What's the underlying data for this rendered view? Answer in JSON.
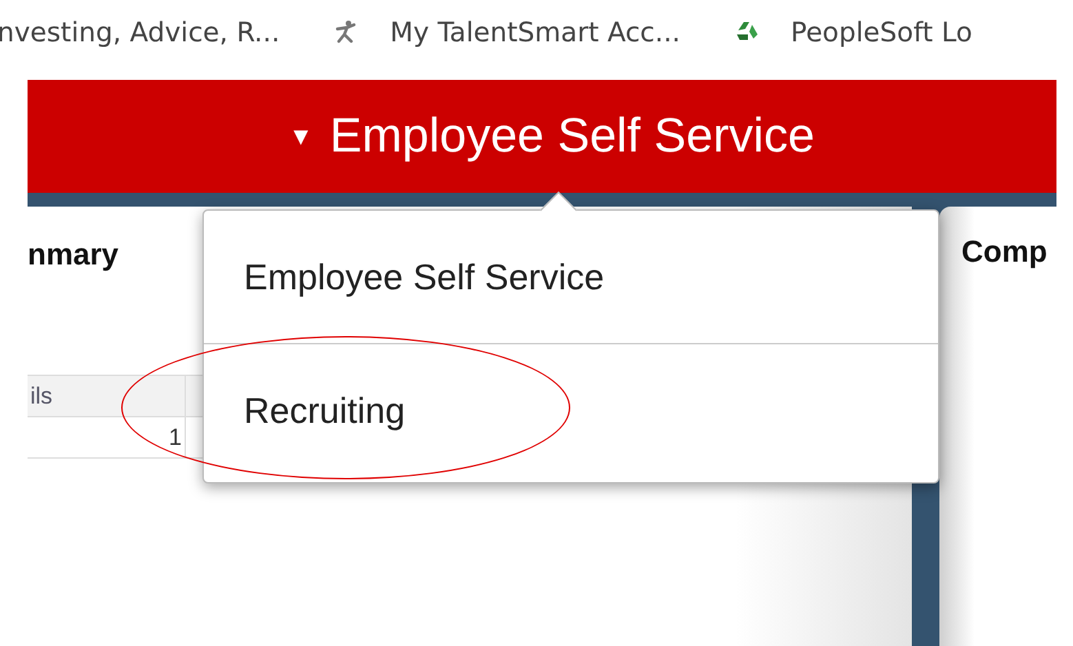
{
  "bookmarks": [
    {
      "label": "nvesting, Advice, R..."
    },
    {
      "label": "My TalentSmart Acc..."
    },
    {
      "label": "PeopleSoft Lo"
    }
  ],
  "header": {
    "caret": "▼",
    "title": "Employee Self Service"
  },
  "left_tile": {
    "title": "nmary",
    "columns": [
      "ils"
    ],
    "rows": [
      [
        "1",
        ""
      ]
    ]
  },
  "right_tile": {
    "title": "Comp"
  },
  "menu": {
    "items": [
      {
        "label": "Employee Self Service",
        "circled": false
      },
      {
        "label": "Recruiting",
        "circled": true
      }
    ]
  }
}
